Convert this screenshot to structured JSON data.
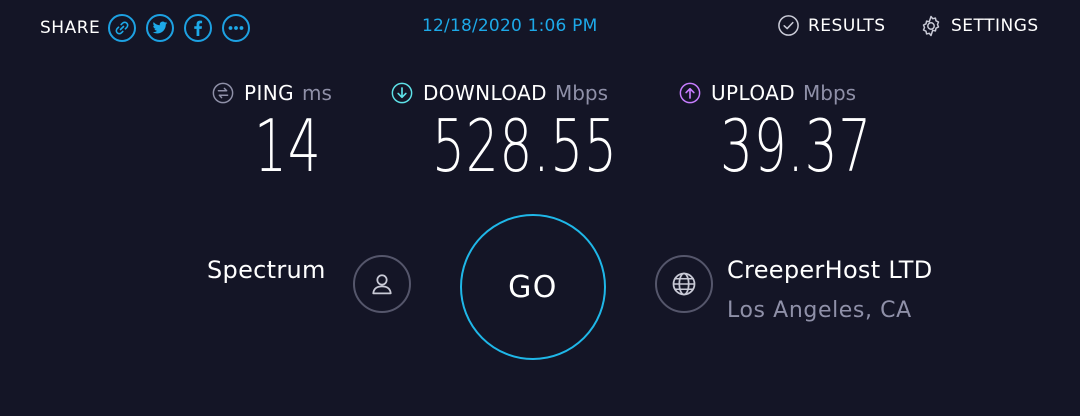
{
  "header": {
    "share_label": "SHARE",
    "share_buttons": [
      {
        "icon": "link-icon"
      },
      {
        "icon": "twitter-icon"
      },
      {
        "icon": "facebook-icon"
      },
      {
        "icon": "more-icon"
      }
    ],
    "timestamp": "12/18/2020 1:06 PM",
    "results_label": "RESULTS",
    "settings_label": "SETTINGS"
  },
  "metrics": {
    "ping": {
      "name": "PING",
      "unit": "ms",
      "value": "14"
    },
    "download": {
      "name": "DOWNLOAD",
      "unit": "Mbps",
      "value": "528.55"
    },
    "upload": {
      "name": "UPLOAD",
      "unit": "Mbps",
      "value": "39.37"
    }
  },
  "isp": {
    "name": "Spectrum"
  },
  "go": {
    "label": "GO"
  },
  "server": {
    "name": "CreeperHost LTD",
    "location": "Los Angeles, CA"
  },
  "colors": {
    "background": "#141526",
    "accent_blue": "#1da9e8",
    "download_icon": "#5ee2e8",
    "upload_icon": "#c77dff",
    "muted_text": "#8f90a8"
  }
}
